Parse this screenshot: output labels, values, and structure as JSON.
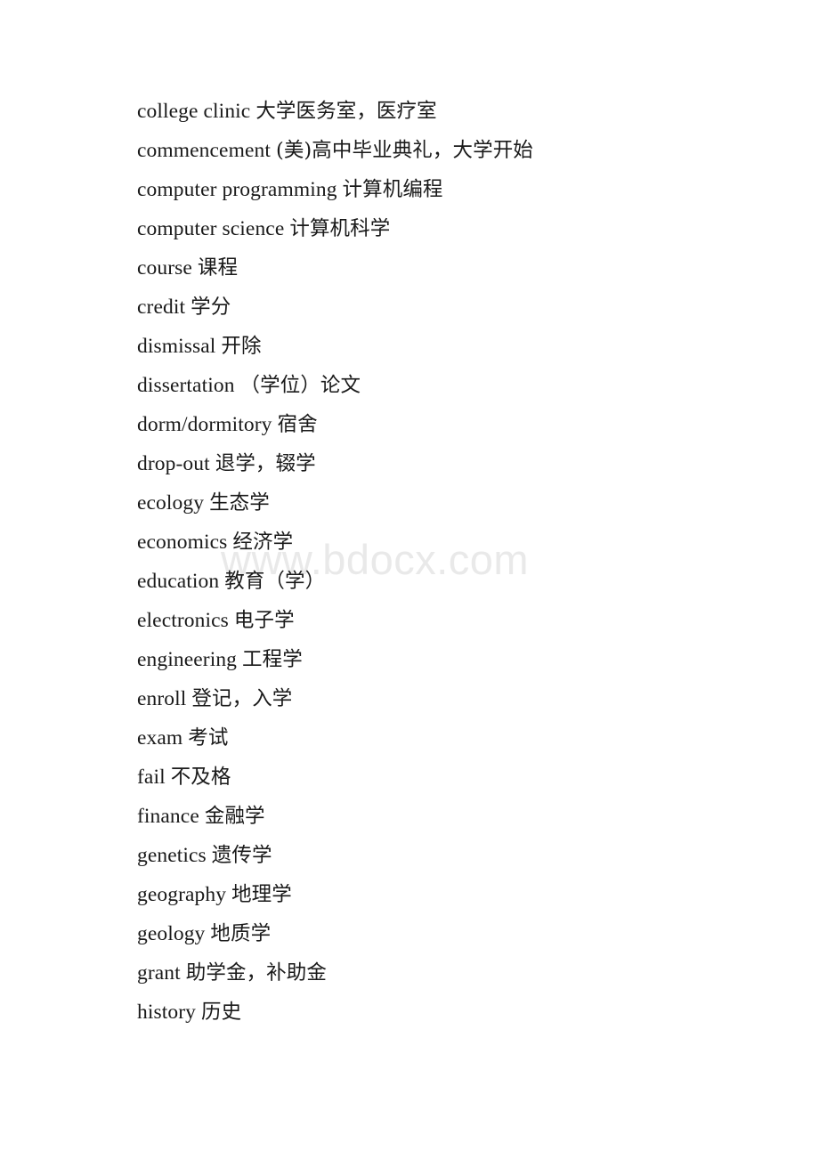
{
  "document": {
    "watermark": "www.bdocx.com",
    "entries": [
      {
        "term": "college clinic",
        "gloss": "大学医务室，医疗室"
      },
      {
        "term": "commencement",
        "gloss": "(美)高中毕业典礼，大学开始"
      },
      {
        "term": "computer programming",
        "gloss": "计算机编程"
      },
      {
        "term": "computer science",
        "gloss": "计算机科学"
      },
      {
        "term": "course",
        "gloss": "课程"
      },
      {
        "term": "credit",
        "gloss": "学分"
      },
      {
        "term": "dismissal",
        "gloss": "开除"
      },
      {
        "term": "dissertation",
        "gloss": "（学位）论文"
      },
      {
        "term": "dorm/dormitory",
        "gloss": "宿舍"
      },
      {
        "term": "drop-out",
        "gloss": "退学，辍学"
      },
      {
        "term": "ecology",
        "gloss": "生态学"
      },
      {
        "term": "economics",
        "gloss": "经济学"
      },
      {
        "term": "education",
        "gloss": "教育（学）"
      },
      {
        "term": "electronics",
        "gloss": "电子学"
      },
      {
        "term": "engineering",
        "gloss": "工程学"
      },
      {
        "term": "enroll",
        "gloss": "登记，入学"
      },
      {
        "term": "exam",
        "gloss": "考试"
      },
      {
        "term": "fail",
        "gloss": "不及格"
      },
      {
        "term": "finance",
        "gloss": "金融学"
      },
      {
        "term": "genetics",
        "gloss": "遗传学"
      },
      {
        "term": "geography",
        "gloss": "地理学"
      },
      {
        "term": "geology",
        "gloss": "地质学"
      },
      {
        "term": "grant",
        "gloss": "助学金，补助金"
      },
      {
        "term": "history",
        "gloss": "历史"
      }
    ]
  }
}
